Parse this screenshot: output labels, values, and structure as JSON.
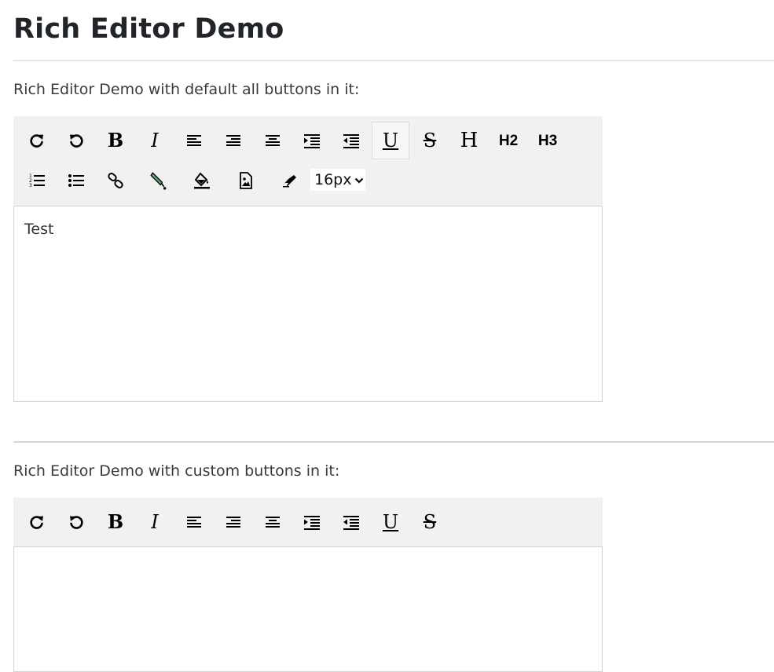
{
  "page": {
    "title": "Rich Editor Demo"
  },
  "editor1": {
    "intro": "Rich Editor Demo with default all buttons in it:",
    "toolbar_row1": [
      {
        "name": "redo-button",
        "icon": "redo-icon"
      },
      {
        "name": "undo-button",
        "icon": "undo-icon"
      },
      {
        "name": "bold-button",
        "icon": "bold-icon",
        "glyph": "B"
      },
      {
        "name": "italic-button",
        "icon": "italic-icon",
        "glyph": "I"
      },
      {
        "name": "align-left-button",
        "icon": "align-left-icon"
      },
      {
        "name": "align-right-button",
        "icon": "align-right-icon"
      },
      {
        "name": "align-center-button",
        "icon": "align-center-icon"
      },
      {
        "name": "indent-button",
        "icon": "indent-icon"
      },
      {
        "name": "outdent-button",
        "icon": "outdent-icon"
      },
      {
        "name": "underline-button",
        "icon": "underline-icon",
        "glyph": "U",
        "active": true
      },
      {
        "name": "strikethrough-button",
        "icon": "strikethrough-icon",
        "glyph": "S"
      },
      {
        "name": "heading-button",
        "icon": "heading-icon",
        "glyph": "H"
      },
      {
        "name": "heading2-button",
        "icon": "h2-icon",
        "glyph": "H2"
      },
      {
        "name": "heading3-button",
        "icon": "h3-icon",
        "glyph": "H3"
      }
    ],
    "toolbar_row2": [
      {
        "name": "ordered-list-button",
        "icon": "ordered-list-icon"
      },
      {
        "name": "unordered-list-button",
        "icon": "unordered-list-icon"
      },
      {
        "name": "link-button",
        "icon": "link-icon"
      },
      {
        "name": "text-color-button",
        "icon": "text-color-icon"
      },
      {
        "name": "background-color-button",
        "icon": "paint-bucket-icon"
      },
      {
        "name": "insert-image-button",
        "icon": "image-icon"
      },
      {
        "name": "clear-format-button",
        "icon": "eraser-icon"
      }
    ],
    "font_size": "16px",
    "content": "Test"
  },
  "editor2": {
    "intro": "Rich Editor Demo with custom buttons in it:",
    "toolbar_row1": [
      {
        "name": "redo-button",
        "icon": "redo-icon"
      },
      {
        "name": "undo-button",
        "icon": "undo-icon"
      },
      {
        "name": "bold-button",
        "icon": "bold-icon",
        "glyph": "B"
      },
      {
        "name": "italic-button",
        "icon": "italic-icon",
        "glyph": "I"
      },
      {
        "name": "align-left-button",
        "icon": "align-left-icon"
      },
      {
        "name": "align-right-button",
        "icon": "align-right-icon"
      },
      {
        "name": "align-center-button",
        "icon": "align-center-icon"
      },
      {
        "name": "indent-button",
        "icon": "indent-icon"
      },
      {
        "name": "outdent-button",
        "icon": "outdent-icon"
      },
      {
        "name": "underline-button",
        "icon": "underline-icon",
        "glyph": "U"
      },
      {
        "name": "strikethrough-button",
        "icon": "strikethrough-icon",
        "glyph": "S"
      }
    ],
    "content": ""
  },
  "colors": {
    "toolbar_bg": "#f2f1f0",
    "text_color_icon_fill": "#5aa37a"
  }
}
